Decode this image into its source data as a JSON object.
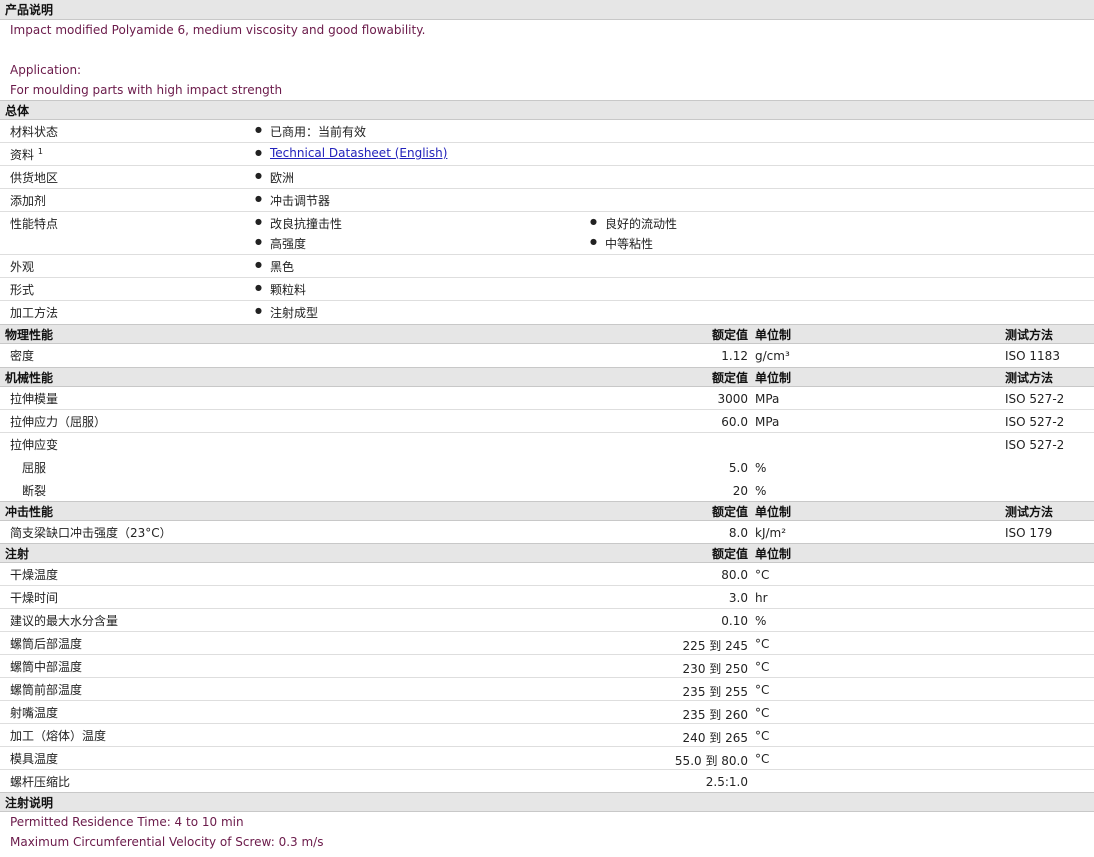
{
  "desc": {
    "title": "产品说明",
    "line1": "Impact modified Polyamide 6, medium viscosity and good flowability.",
    "line2": "Application:",
    "line3": "For moulding parts with high impact strength"
  },
  "general": {
    "title": "总体",
    "status_label": "材料状态",
    "status_value": "已商用：当前有效",
    "docs_label": "资料",
    "docs_sup": "1",
    "docs_link": "Technical Datasheet (English)",
    "region_label": "供货地区",
    "region_value": "欧洲",
    "additive_label": "添加剂",
    "additive_value": "冲击调节器",
    "features_label": "性能特点",
    "features": [
      "改良抗撞击性",
      "良好的流动性",
      "高强度",
      "中等粘性"
    ],
    "appearance_label": "外观",
    "appearance_value": "黑色",
    "form_label": "形式",
    "form_value": "颗粒料",
    "method_label": "加工方法",
    "method_value": "注射成型"
  },
  "headers": {
    "nominal": "额定值",
    "unit": "单位制",
    "test": "测试方法"
  },
  "physical": {
    "title": "物理性能",
    "rows": [
      {
        "label": "密度",
        "value": "1.12",
        "unit": "g/cm³",
        "method": "ISO 1183"
      }
    ]
  },
  "mechanical": {
    "title": "机械性能",
    "rows": [
      {
        "label": "拉伸模量",
        "value": "3000",
        "unit": "MPa",
        "method": "ISO 527-2"
      },
      {
        "label": "拉伸应力（屈服）",
        "value": "60.0",
        "unit": "MPa",
        "method": "ISO 527-2"
      },
      {
        "label": "拉伸应变",
        "value": "",
        "unit": "",
        "method": "ISO 527-2"
      },
      {
        "label": "屈服",
        "value": "5.0",
        "unit": "%",
        "method": ""
      },
      {
        "label": "断裂",
        "value": "20",
        "unit": "%",
        "method": ""
      }
    ]
  },
  "impact": {
    "title": "冲击性能",
    "rows": [
      {
        "label": "简支梁缺口冲击强度（23°C）",
        "value": "8.0",
        "unit": "kJ/m²",
        "method": "ISO 179"
      }
    ]
  },
  "injection": {
    "title": "注射",
    "rows": [
      {
        "label": "干燥温度",
        "value": "80.0",
        "unit": "°C"
      },
      {
        "label": "干燥时间",
        "value": "3.0",
        "unit": "hr"
      },
      {
        "label": "建议的最大水分含量",
        "value": "0.10",
        "unit": "%"
      },
      {
        "label": "螺筒后部温度",
        "value": "225 到  245",
        "unit": "°C"
      },
      {
        "label": "螺筒中部温度",
        "value": "230 到  250",
        "unit": "°C"
      },
      {
        "label": "螺筒前部温度",
        "value": "235 到  255",
        "unit": "°C"
      },
      {
        "label": "射嘴温度",
        "value": "235 到  260",
        "unit": "°C"
      },
      {
        "label": "加工（熔体）温度",
        "value": "240 到  265",
        "unit": "°C"
      },
      {
        "label": "模具温度",
        "value": "55.0 到  80.0",
        "unit": "°C"
      },
      {
        "label": "螺杆压缩比",
        "value": "2.5:1.0",
        "unit": ""
      }
    ]
  },
  "notes": {
    "title": "注射说明",
    "line1": "Permitted Residence Time: 4 to 10 min",
    "line2": "Maximum Circumferential Velocity of Screw: 0.3 m/s"
  }
}
